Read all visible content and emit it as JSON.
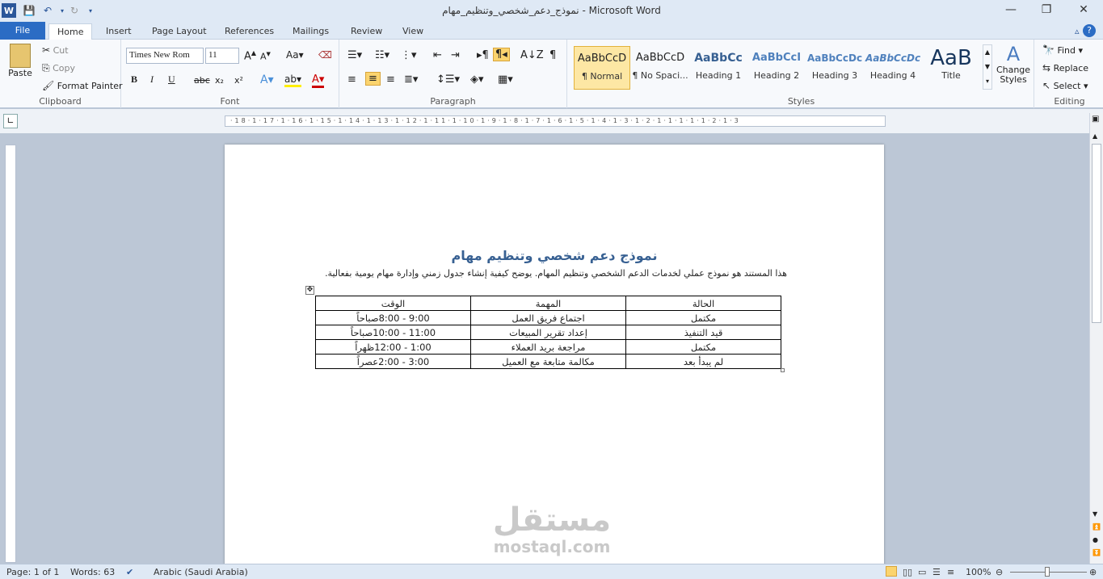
{
  "window": {
    "title": "نموذج_دعم_شخصي_وتنظيم_مهام  -  Microsoft Word",
    "minimize": "—",
    "restore": "❐",
    "close": "✕"
  },
  "tabs": [
    "File",
    "Home",
    "Insert",
    "Page Layout",
    "References",
    "Mailings",
    "Review",
    "View"
  ],
  "clipboard": {
    "paste": "Paste",
    "cut": "Cut",
    "copy": "Copy",
    "format_painter": "Format Painter",
    "label": "Clipboard"
  },
  "font": {
    "name": "Times New Rom",
    "size": "11",
    "label": "Font",
    "bold": "B",
    "italic": "I",
    "underline": "U",
    "strike": "abc",
    "sub": "x₂",
    "sup": "x²"
  },
  "paragraph": {
    "label": "Paragraph"
  },
  "styles": {
    "label": "Styles",
    "items": [
      {
        "sample": "AaBbCcD",
        "name": "¶ Normal"
      },
      {
        "sample": "AaBbCcD",
        "name": "¶ No Spaci..."
      },
      {
        "sample": "AaBbCc",
        "name": "Heading 1"
      },
      {
        "sample": "AaBbCcI",
        "name": "Heading 2"
      },
      {
        "sample": "AaBbCcDc",
        "name": "Heading 3"
      },
      {
        "sample": "AaBbCcDc",
        "name": "Heading 4"
      },
      {
        "sample": "AaB",
        "name": "Title"
      }
    ],
    "change": "Change Styles"
  },
  "editing": {
    "label": "Editing",
    "find": "Find",
    "replace": "Replace",
    "select": "Select"
  },
  "document": {
    "title": "نموذج دعم شخصي وتنظيم مهام",
    "paragraph": "هذا المستند هو نموذج عملي لخدمات الدعم الشخصي وتنظيم المهام. يوضح كيفية إنشاء جدول زمني وإدارة مهام يومية بفعالية.",
    "table": {
      "headers": [
        "الحالة",
        "المهمة",
        "الوقت"
      ],
      "rows": [
        [
          "مكتمل",
          "اجتماع فريق العمل",
          "9:00 - 8:00صباحاً"
        ],
        [
          "قيد التنفيذ",
          "إعداد تقرير المبيعات",
          "11:00 - 10:00صباحاً"
        ],
        [
          "مكتمل",
          "مراجعة بريد العملاء",
          "1:00 - 12:00ظهراً"
        ],
        [
          "لم يبدأ بعد",
          "مكالمة متابعة مع العميل",
          "3:00 - 2:00عصراً"
        ]
      ]
    }
  },
  "status": {
    "page": "Page: 1 of 1",
    "words": "Words: 63",
    "language": "Arabic (Saudi Arabia)",
    "zoom": "100%"
  },
  "watermark": {
    "ar": "مستقل",
    "en": "mostaql.com"
  }
}
